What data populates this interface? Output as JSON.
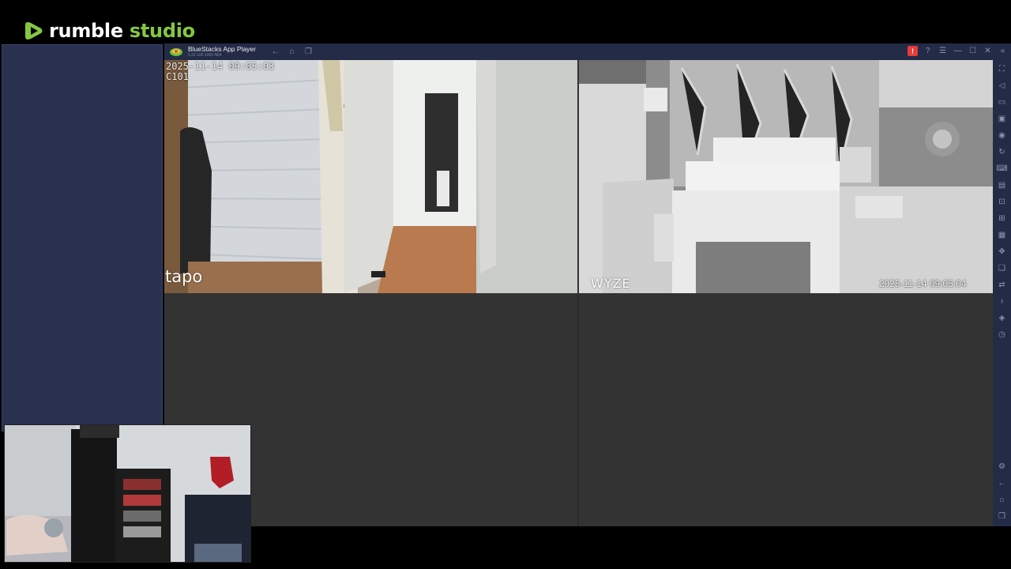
{
  "overlay": {
    "brand_word1": "rumble",
    "brand_word2": "studio"
  },
  "titlebar": {
    "app_title": "BlueStacks App Player",
    "version": "5.22.100.1005 N64",
    "nav_icons": [
      "back-icon",
      "home-icon",
      "multi-instance-icon"
    ],
    "right_icons": [
      "alert-icon",
      "help-icon",
      "menu-icon",
      "minimize-icon",
      "maximize-icon",
      "close-icon",
      "collapse-sidebar-icon"
    ]
  },
  "cameras": [
    {
      "timestamp": "2025-11-14 09:05:03",
      "label": "C101",
      "brand": "tapo"
    },
    {
      "timestamp": "2025-11-14 09:05:04",
      "brand": "WYZE"
    }
  ],
  "sidebar_icons": [
    "fullscreen-icon",
    "volume-icon",
    "keyboard-icon",
    "screenshot-icon",
    "record-icon",
    "rotate-icon",
    "gamepad-icon",
    "macro-icon",
    "screen-capture-icon",
    "camera-icon",
    "media-icon",
    "location-icon",
    "multi-instance-icon",
    "sync-icon",
    "eco-icon",
    "layers-icon",
    "clock-icon",
    "settings-icon",
    "back-icon",
    "home-icon",
    "recent-apps-icon"
  ],
  "colors": {
    "accent": "#85c742",
    "alert": "#e43c3c",
    "frame": "#242b46"
  }
}
